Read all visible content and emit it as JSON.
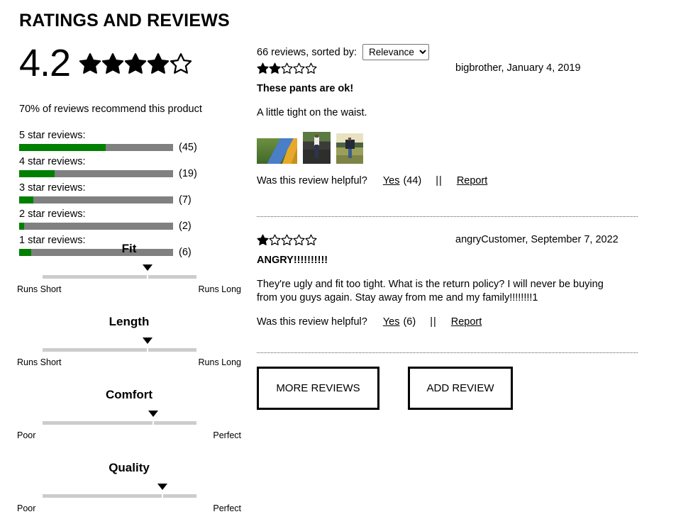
{
  "page_title": "RATINGS AND REVIEWS",
  "summary": {
    "score": "4.2",
    "score_value": 4.2,
    "max_stars": 5,
    "recommend_text": "70% of reviews recommend this product",
    "breakdown": [
      {
        "label": "5 star reviews:",
        "count": "(45)",
        "value": 45,
        "fill_percent": 56
      },
      {
        "label": "4 star reviews:",
        "count": "(19)",
        "value": 19,
        "fill_percent": 23
      },
      {
        "label": "3 star reviews:",
        "count": "(7)",
        "value": 7,
        "fill_percent": 9
      },
      {
        "label": "2 star reviews:",
        "count": "(2)",
        "value": 2,
        "fill_percent": 3
      },
      {
        "label": "1 star reviews:",
        "count": "(6)",
        "value": 6,
        "fill_percent": 8
      }
    ]
  },
  "attributes": [
    {
      "title": "Fit",
      "left_label": "Runs Short",
      "right_label": "Runs Long",
      "marker_percent": 68
    },
    {
      "title": "Length",
      "left_label": "Runs Short",
      "right_label": "Runs Long",
      "marker_percent": 68
    },
    {
      "title": "Comfort",
      "left_label": "Poor",
      "right_label": "Perfect",
      "marker_percent": 72
    },
    {
      "title": "Quality",
      "left_label": "Poor",
      "right_label": "Perfect",
      "marker_percent": 78
    }
  ],
  "reviews_header": {
    "count_text": "66 reviews, sorted by:",
    "sort_selected": "Relevance",
    "sort_options": [
      "Relevance"
    ]
  },
  "reviews": [
    {
      "rating": 2,
      "author_date": "bigbrother, January 4, 2019",
      "title": "These pants are ok!",
      "body": "A little tight on the waist.",
      "photos": [
        "photo-person-lying-grass",
        "photo-person-standing-rocks",
        "photo-person-standing-field"
      ],
      "helpful_question": "Was this review helpful?",
      "helpful_yes": "Yes",
      "helpful_count": "(44)",
      "separator": "||",
      "report": "Report"
    },
    {
      "rating": 1,
      "author_date": "angryCustomer, September 7, 2022",
      "title": "ANGRY!!!!!!!!!!",
      "body": "They're ugly and fit too tight. What is the return policy? I will never be buying from you guys again. Stay away from me and my family!!!!!!!!1",
      "photos": [],
      "helpful_question": "Was this review helpful?",
      "helpful_yes": "Yes",
      "helpful_count": "(6)",
      "separator": "||",
      "report": "Report"
    }
  ],
  "actions": {
    "more_reviews": "MORE REVIEWS",
    "add_review": "ADD REVIEW"
  },
  "colors": {
    "bar_fill": "#008000",
    "bar_track": "#808080",
    "slider_track": "#cccccc",
    "marker": "#000000",
    "text": "#000000",
    "background": "#ffffff"
  }
}
